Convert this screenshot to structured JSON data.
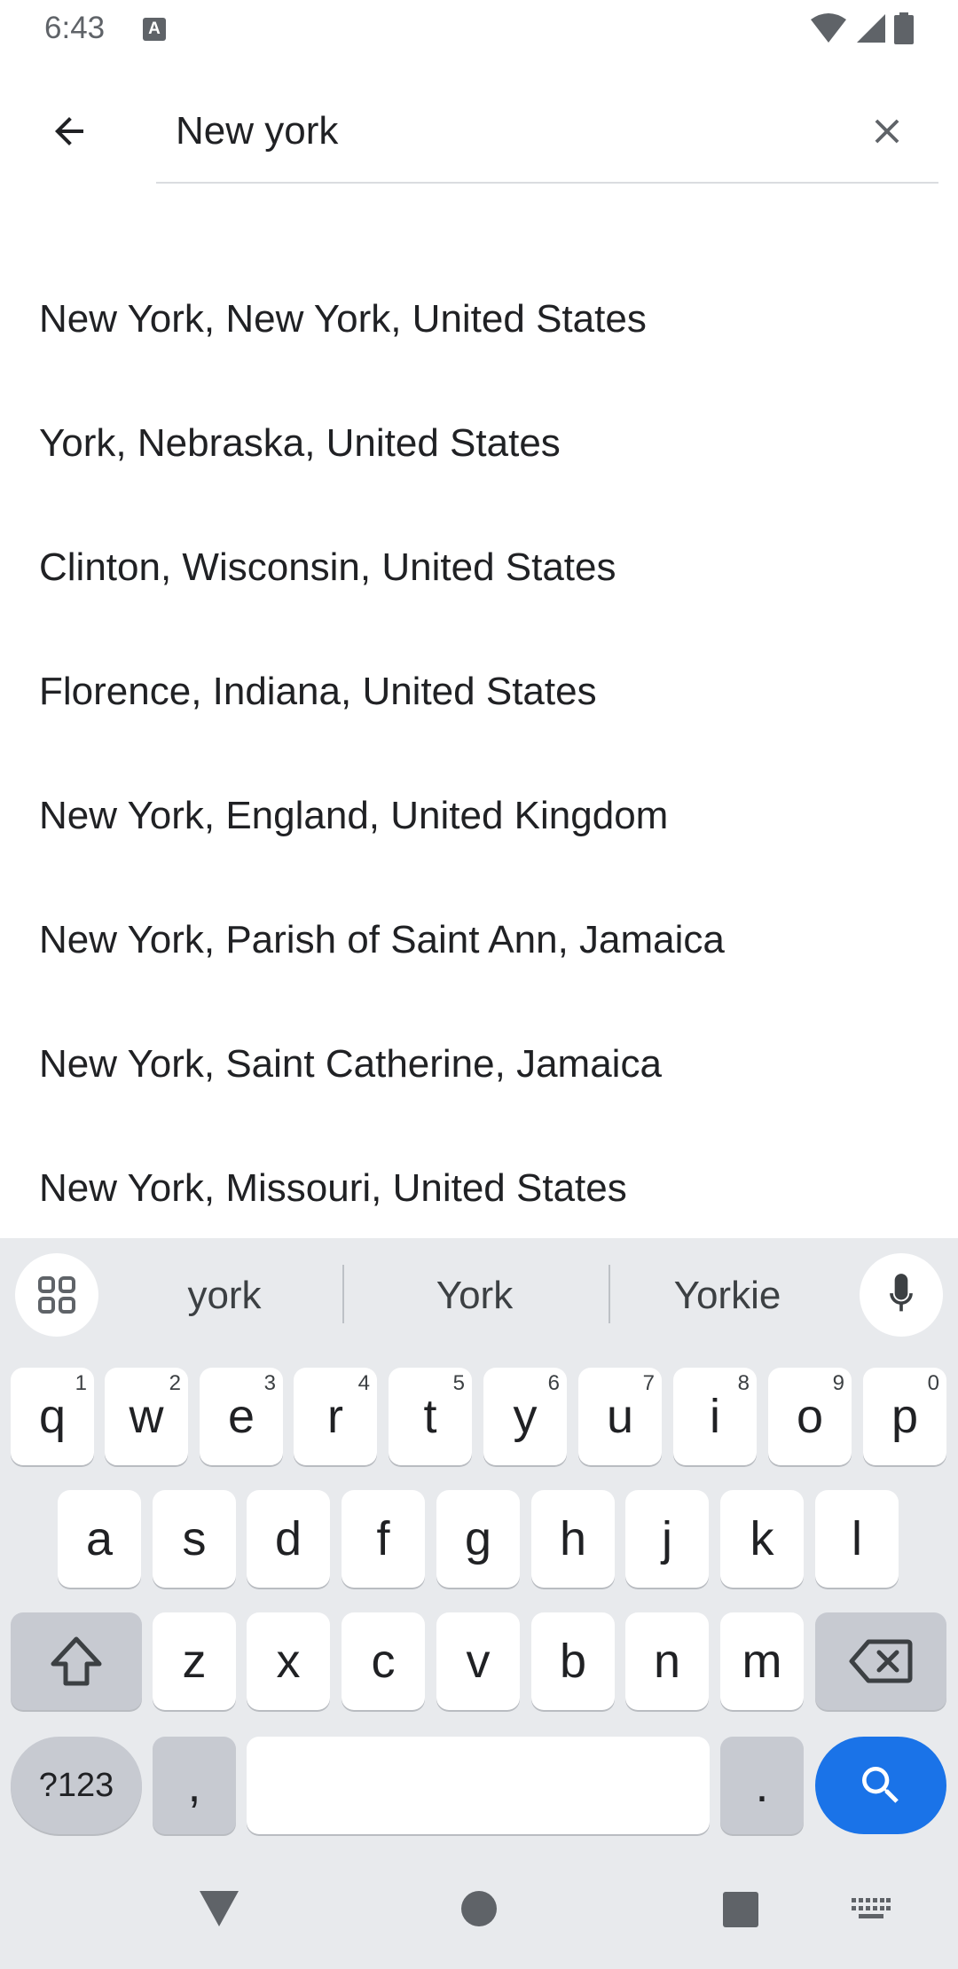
{
  "status_bar": {
    "time": "6:43",
    "notification_icon": "A"
  },
  "search": {
    "value": "New york"
  },
  "results": [
    "New York, New York, United States",
    "York, Nebraska, United States",
    "Clinton, Wisconsin, United States",
    "Florence, Indiana, United States",
    "New York, England, United Kingdom",
    "New York, Parish of Saint Ann, Jamaica",
    "New York, Saint Catherine, Jamaica",
    "New York, Missouri, United States"
  ],
  "keyboard": {
    "suggestions": [
      "york",
      "York",
      "Yorkie"
    ],
    "row1": [
      {
        "key": "q",
        "hint": "1"
      },
      {
        "key": "w",
        "hint": "2"
      },
      {
        "key": "e",
        "hint": "3"
      },
      {
        "key": "r",
        "hint": "4"
      },
      {
        "key": "t",
        "hint": "5"
      },
      {
        "key": "y",
        "hint": "6"
      },
      {
        "key": "u",
        "hint": "7"
      },
      {
        "key": "i",
        "hint": "8"
      },
      {
        "key": "o",
        "hint": "9"
      },
      {
        "key": "p",
        "hint": "0"
      }
    ],
    "row2": [
      "a",
      "s",
      "d",
      "f",
      "g",
      "h",
      "j",
      "k",
      "l"
    ],
    "row3": [
      "z",
      "x",
      "c",
      "v",
      "b",
      "n",
      "m"
    ],
    "symbols_label": "?123",
    "comma_label": ",",
    "period_label": "."
  },
  "colors": {
    "accent": "#1a73e8",
    "keyboard_bg": "#e8eaed",
    "text": "#202124"
  }
}
